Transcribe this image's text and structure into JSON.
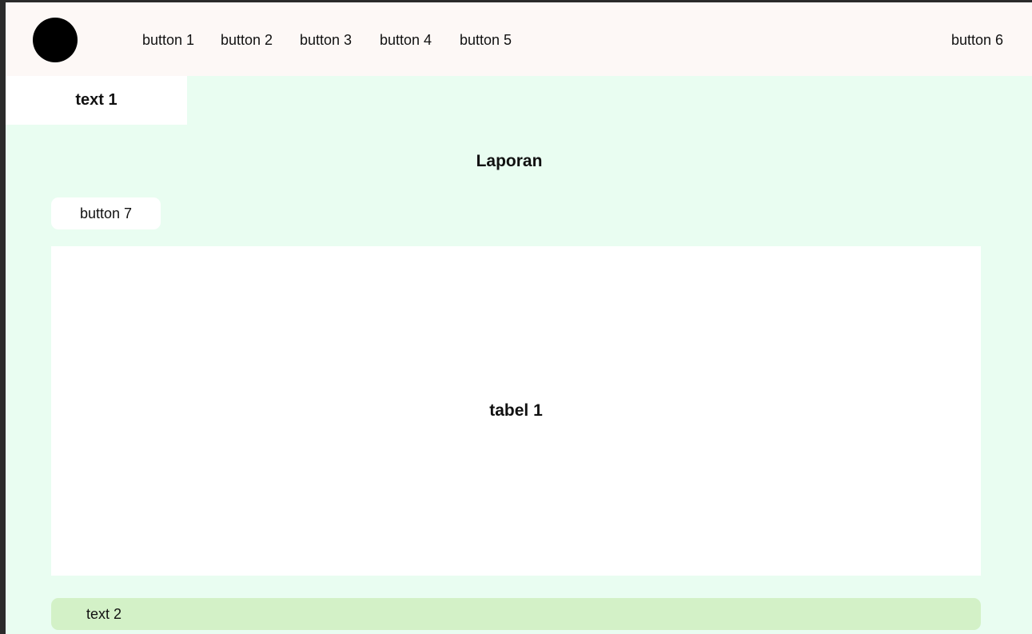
{
  "header": {
    "nav": [
      {
        "label": "button 1"
      },
      {
        "label": "button 2"
      },
      {
        "label": "button 3"
      },
      {
        "label": "button 4"
      },
      {
        "label": "button 5"
      }
    ],
    "right_button": "button 6"
  },
  "tab": {
    "label": "text 1"
  },
  "main": {
    "title": "Laporan",
    "action_button": "button 7",
    "table_placeholder": "tabel 1",
    "footer_text": "text 2"
  },
  "colors": {
    "header_bg": "#fdf8f6",
    "page_bg": "#e9fdf1",
    "footer_bar_bg": "#d3f1c7",
    "logo": "#000000"
  }
}
